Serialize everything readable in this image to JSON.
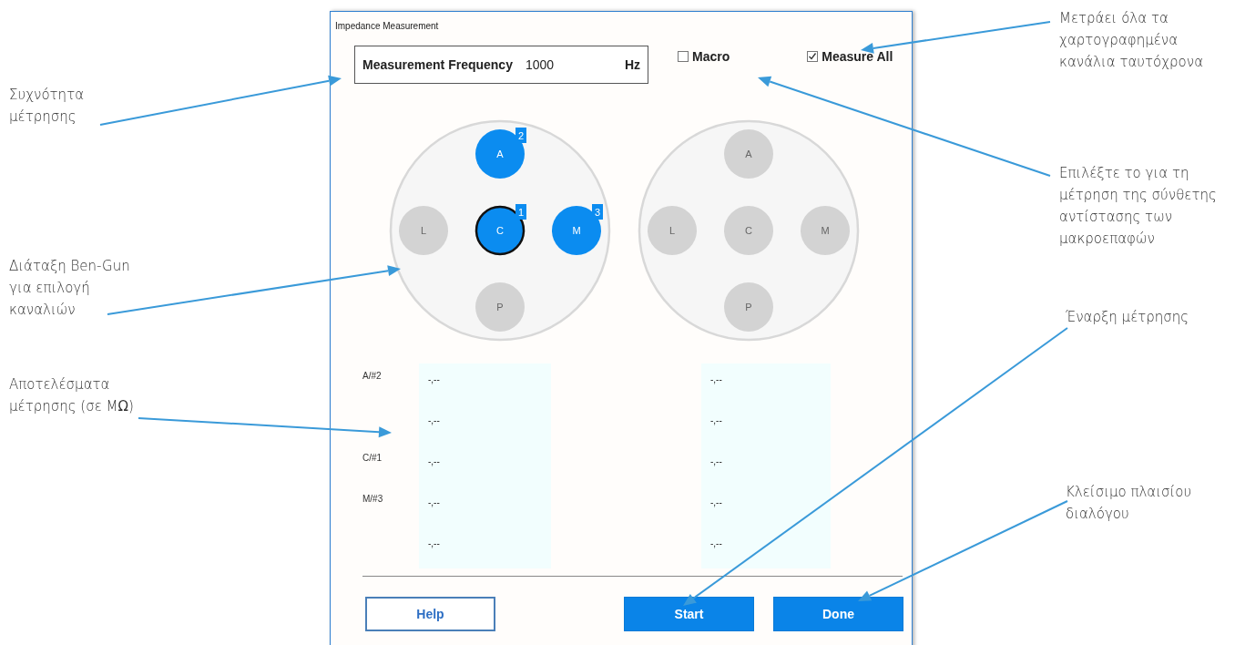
{
  "dialog": {
    "title": "Impedance Measurement",
    "frequency": {
      "label": "Measurement Frequency",
      "value": "1000",
      "unit": "Hz"
    },
    "options": [
      {
        "label": "Macro",
        "checked": false
      },
      {
        "label": "Measure All",
        "checked": true
      }
    ],
    "arrays": [
      {
        "electrodes": [
          {
            "label": "A",
            "selected": true,
            "channel": "2",
            "focused": false
          },
          {
            "label": "L",
            "selected": false,
            "focused": false
          },
          {
            "label": "C",
            "selected": true,
            "channel": "1",
            "focused": true
          },
          {
            "label": "M",
            "selected": true,
            "channel": "3",
            "focused": false
          },
          {
            "label": "P",
            "selected": false,
            "focused": false
          }
        ]
      },
      {
        "electrodes": [
          {
            "label": "A",
            "selected": false,
            "focused": false
          },
          {
            "label": "L",
            "selected": false,
            "focused": false
          },
          {
            "label": "C",
            "selected": false,
            "focused": false
          },
          {
            "label": "M",
            "selected": false,
            "focused": false
          },
          {
            "label": "P",
            "selected": false,
            "focused": false
          }
        ]
      }
    ],
    "results": [
      {
        "label": "A/#2",
        "values": [
          "-,--",
          "-,--"
        ]
      },
      {
        "values": [
          "-,--",
          "-,--"
        ]
      },
      {
        "label": "C/#1",
        "values": [
          "-,--",
          "-,--"
        ]
      },
      {
        "label": "M/#3",
        "values": [
          "-,--",
          "-,--"
        ]
      },
      {
        "values": [
          "-,--",
          "-,--"
        ]
      }
    ],
    "buttons": [
      {
        "label": "Help",
        "kind": "outline"
      },
      {
        "label": "Start",
        "kind": "primary"
      },
      {
        "label": "Done",
        "kind": "primary"
      }
    ]
  },
  "callouts": [
    {
      "text": "Συχνότητα μέτρησης"
    },
    {
      "text": "Διάταξη Ben-Gun για επιλογή καναλιών"
    },
    {
      "text": "Αποτελέσματα μέτρησης (σε M**Ω**)"
    },
    {
      "text": "Μετράει όλα τα χαρτογραφημένα κανάλια ταυτόχρονα"
    },
    {
      "text": "Επιλέξτε το για τη μέτρηση της σύνθετης αντίστασης των μακροεπαφών"
    },
    {
      "text": "Έναρξη μέτρησης"
    },
    {
      "text": "Κλείσιμο πλαισίου διαλόγου"
    }
  ]
}
